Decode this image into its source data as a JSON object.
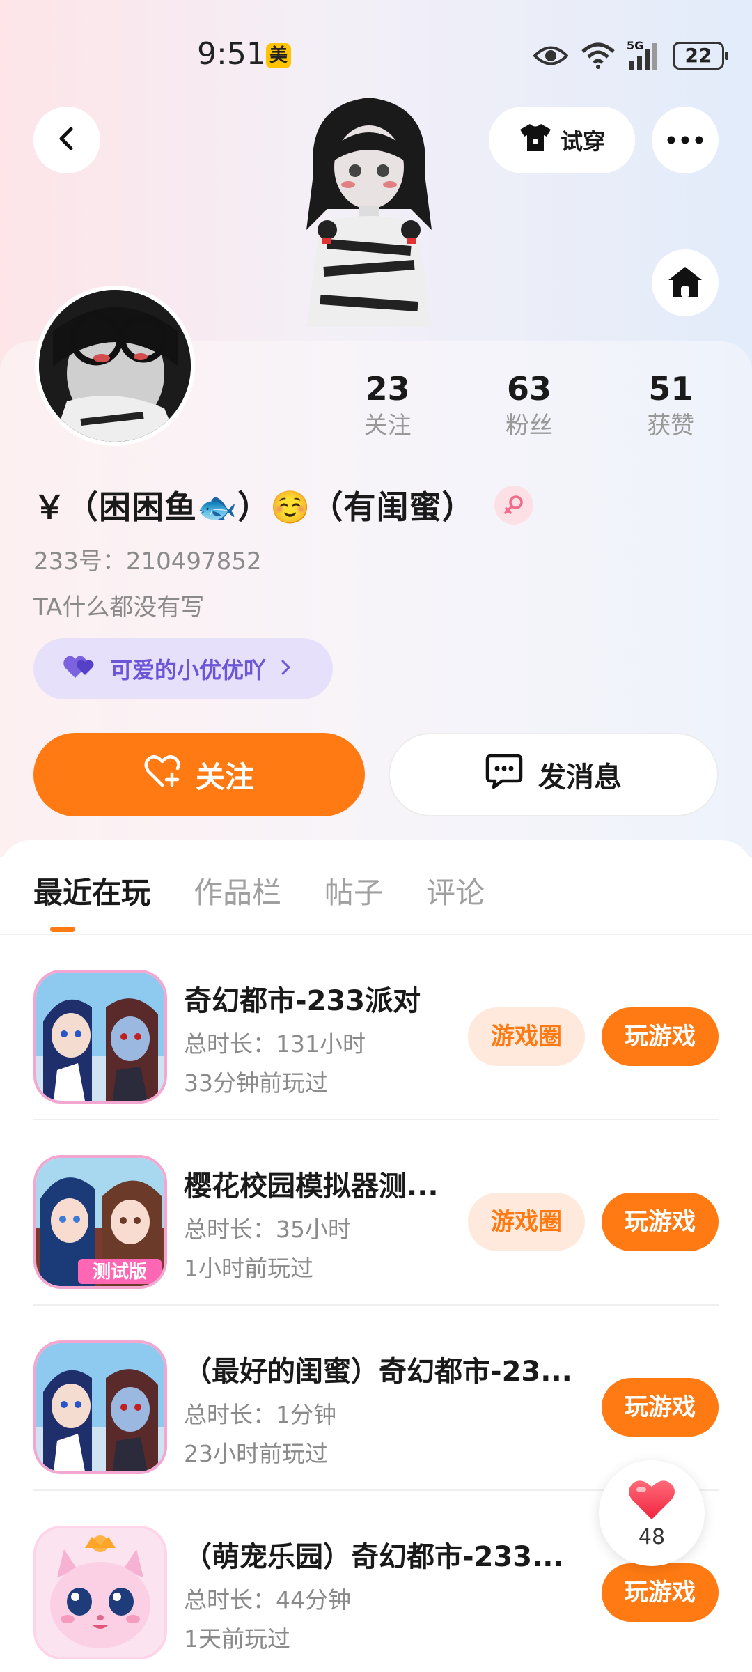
{
  "status_bar": {
    "time": "9:51",
    "app_badge": "美",
    "network": "5G",
    "battery": "22"
  },
  "header": {
    "tryon_label": "试穿"
  },
  "profile": {
    "stats": [
      {
        "value": "23",
        "label": "关注"
      },
      {
        "value": "63",
        "label": "粉丝"
      },
      {
        "value": "51",
        "label": "获赞"
      }
    ],
    "nickname": "￥（困困鱼🐟）☺️（有闺蜜）",
    "uid": "233号：210497852",
    "bio": "TA什么都没有写",
    "bestie_tag": "可爱的小优优吖"
  },
  "actions": {
    "follow_label": "关注",
    "message_label": "发消息"
  },
  "tabs": [
    {
      "label": "最近在玩",
      "active": true
    },
    {
      "label": "作品栏",
      "active": false
    },
    {
      "label": "帖子",
      "active": false
    },
    {
      "label": "评论",
      "active": false
    }
  ],
  "games": [
    {
      "title": "奇幻都市-233派对",
      "duration": "总时长：131小时",
      "last_played": "33分钟前玩过",
      "circle_label": "游戏圈",
      "play_label": "玩游戏"
    },
    {
      "title": "樱花校园模拟器测...",
      "duration": "总时长：35小时",
      "last_played": "1小时前玩过",
      "circle_label": "游戏圈",
      "play_label": "玩游戏",
      "icon_badge": "测试版"
    },
    {
      "title": "（最好的闺蜜）奇幻都市-23...",
      "duration": "总时长：1分钟",
      "last_played": "23小时前玩过",
      "play_label": "玩游戏"
    },
    {
      "title": "（萌宠乐园）奇幻都市-233...",
      "duration": "总时长：44分钟",
      "last_played": "1天前玩过",
      "play_label": "玩游戏"
    }
  ],
  "floating_like": {
    "count": "48"
  },
  "colors": {
    "accent": "#ff7a12",
    "accent_light": "#ffe9dc",
    "bestie_bg": "#e6e0fa",
    "bestie_text": "#6a56d6"
  }
}
